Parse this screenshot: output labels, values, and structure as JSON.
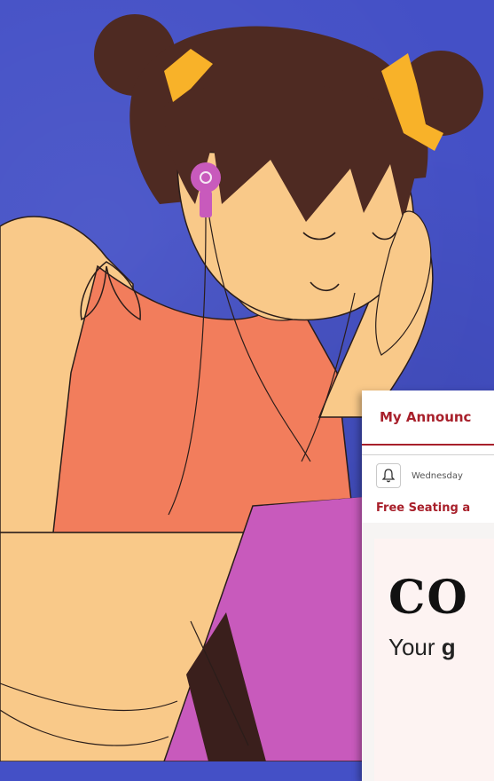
{
  "card": {
    "title": "My Announc",
    "date": "Wednesday",
    "subtitle": "Free Seating a",
    "heading": "CO",
    "text_prefix": "Your ",
    "text_bold": "g"
  },
  "colors": {
    "background": "#4450c6",
    "skin": "#f9c989",
    "hair": "#4e2a22",
    "bow": "#f8b229",
    "tank_top": "#f27d5c",
    "tablet": "#c85abc",
    "earbud": "#c85abc",
    "accent_red": "#a8202b"
  },
  "icons": {
    "notification": "bell-icon"
  }
}
